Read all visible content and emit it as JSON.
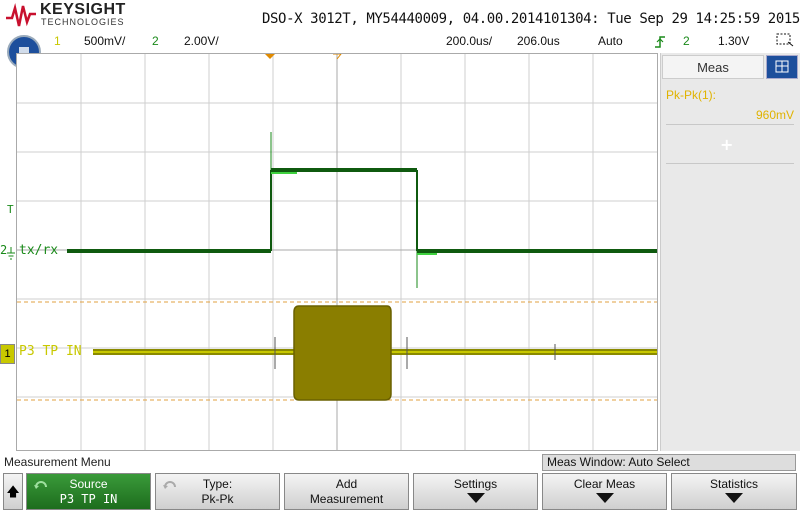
{
  "header": {
    "brand": "KEYSIGHT",
    "brand_sub": "TECHNOLOGIES",
    "model_line": "DSO-X 3012T, MY54440009, 04.00.2014101304: Tue Sep 29 14:25:59 2015",
    "ch1_num": "1",
    "ch1_scale": "500mV/",
    "ch2_num": "2",
    "ch2_scale": "2.00V/",
    "timebase": "200.0us/",
    "delay": "206.0us",
    "trigger_mode": "Auto",
    "trigger_source": "2",
    "trigger_level": "1.30V"
  },
  "traces": {
    "ch2_label": "tx/rx",
    "ch1_label": "P3 TP IN",
    "ch1_marker": "1",
    "ch2_marker": "2",
    "trigger_marker": "T"
  },
  "meas_panel": {
    "tab_label": "Meas",
    "meas_name": "Pk-Pk(1):",
    "meas_value": "960mV",
    "add_symbol": "+"
  },
  "menu": {
    "title": "Measurement Menu",
    "meas_window": "Meas Window: Auto Select",
    "softkeys": [
      {
        "l1": "Source",
        "l2": "P3 TP IN"
      },
      {
        "l1": "Type:",
        "l2": "Pk-Pk"
      },
      {
        "l1": "Add",
        "l2": "Measurement"
      },
      {
        "l1": "Settings",
        "l2": ""
      },
      {
        "l1": "Clear Meas",
        "l2": ""
      },
      {
        "l1": "Statistics",
        "l2": ""
      }
    ]
  },
  "colors": {
    "ch1": "#c8c800",
    "ch2": "#1a8a1a",
    "accent": "#1d4f9c",
    "meas_text": "#e0b300"
  }
}
